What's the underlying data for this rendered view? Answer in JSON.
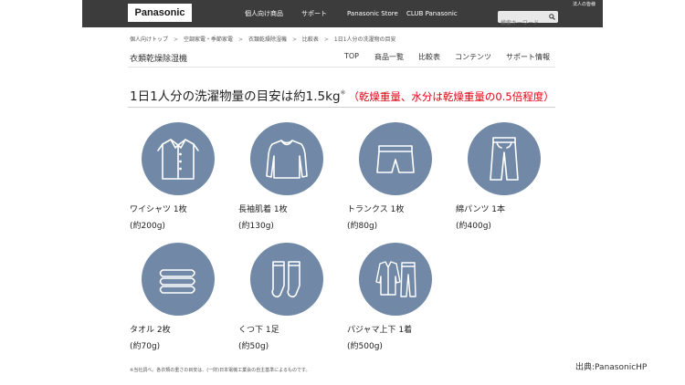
{
  "header": {
    "logo": "Panasonic",
    "nav": [
      "個人向け商品",
      "サポート",
      "Panasonic Store",
      "CLUB Panasonic"
    ],
    "corporate_link": "法人の皆様",
    "search_placeholder": "検索キーワード",
    "search_icon": "magnifier-icon"
  },
  "breadcrumb": [
    "個人向けトップ",
    "空調家電・季節家電",
    "衣類乾燥除湿機",
    "比較表",
    "1日1人分の洗濯物の目安"
  ],
  "breadcrumb_separator": ">",
  "product_title": "衣類乾燥除湿機",
  "subnav": [
    "TOP",
    "商品一覧",
    "比較表",
    "コンテンツ",
    "サポート情報"
  ],
  "heading": {
    "main": "1日1人分の洗濯物量の目安は約1.5kg",
    "sup": "※",
    "note": "（乾燥重量、水分は乾燥重量の0.5倍程度）"
  },
  "icon_color": "#7189a6",
  "items": [
    {
      "name": "ワイシャツ 1枚",
      "weight": "(約200g)",
      "icon": "dress-shirt-icon"
    },
    {
      "name": "長袖肌着 1枚",
      "weight": "(約130g)",
      "icon": "long-sleeve-undershirt-icon"
    },
    {
      "name": "トランクス 1枚",
      "weight": "(約80g)",
      "icon": "trunks-icon"
    },
    {
      "name": "綿パンツ 1本",
      "weight": "(約400g)",
      "icon": "cotton-pants-icon"
    },
    {
      "name": "タオル 2枚",
      "weight": "(約70g)",
      "icon": "towel-icon"
    },
    {
      "name": "くつ下 1足",
      "weight": "(約50g)",
      "icon": "socks-icon"
    },
    {
      "name": "パジャマ上下 1着",
      "weight": "(約500g)",
      "icon": "pajamas-icon"
    }
  ],
  "footnote": "※当社調べ。各衣類の重さの目安は、(一財)日本電機工業会の自主基準によるものです。",
  "source": "出典:PanasonicHP"
}
